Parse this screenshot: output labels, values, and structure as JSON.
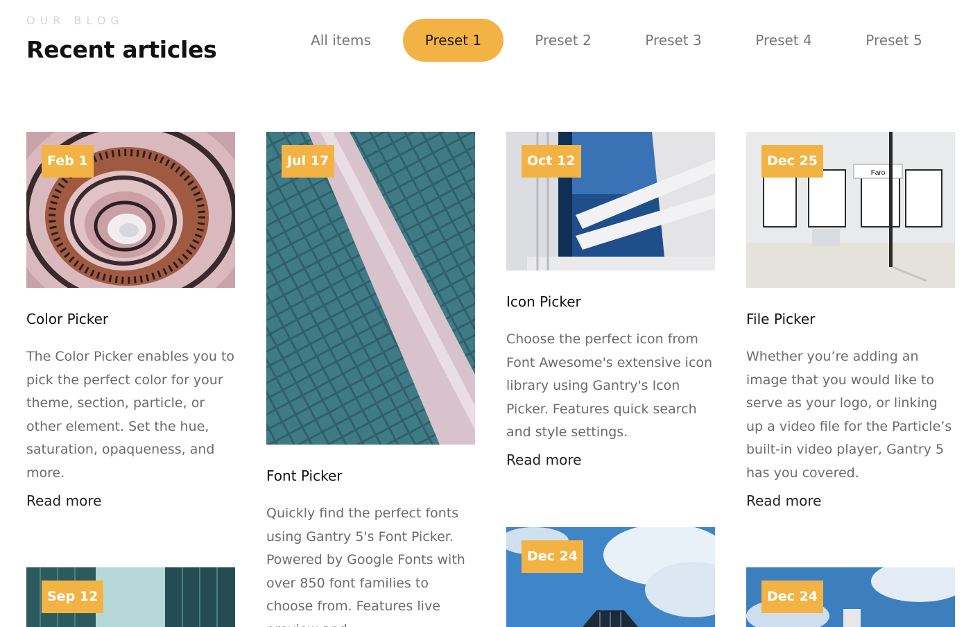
{
  "header": {
    "eyebrow": "OUR BLOG",
    "title": "Recent articles"
  },
  "tabs": [
    {
      "label": "All items",
      "active": false
    },
    {
      "label": "Preset 1",
      "active": true
    },
    {
      "label": "Preset 2",
      "active": false
    },
    {
      "label": "Preset 3",
      "active": false
    },
    {
      "label": "Preset 4",
      "active": false
    },
    {
      "label": "Preset 5",
      "active": false
    }
  ],
  "accent_color": "#f3b344",
  "articles": [
    {
      "date": "Feb 1",
      "title": "Color Picker",
      "excerpt": "The Color Picker enables you to pick the perfect color for your theme, section, particle, or other element. Set the hue, saturation, opaqueness, and more.",
      "read_more": "Read more"
    },
    {
      "date": "Jul 17",
      "title": "Font Picker",
      "excerpt": "Quickly find the perfect fonts using Gantry 5's Font Picker. Powered by Google Fonts with over 850 font families to choose from. Features live preview and"
    },
    {
      "date": "Oct 12",
      "title": "Icon Picker",
      "excerpt": "Choose the perfect icon from Font Awesome's extensive icon library using Gantry's Icon Picker. Features quick search and style settings.",
      "read_more": "Read more"
    },
    {
      "date": "Dec 25",
      "title": "File Picker",
      "excerpt": "Whether you’re adding an image that you would like to serve as your logo, or linking up a video file for the Particle’s built-in video player, Gantry 5 has you covered.",
      "read_more": "Read more",
      "image_sign": "Faro"
    },
    {
      "date": "Sep 12"
    },
    {
      "date": "Dec 24"
    },
    {
      "date": "Dec 24"
    }
  ]
}
